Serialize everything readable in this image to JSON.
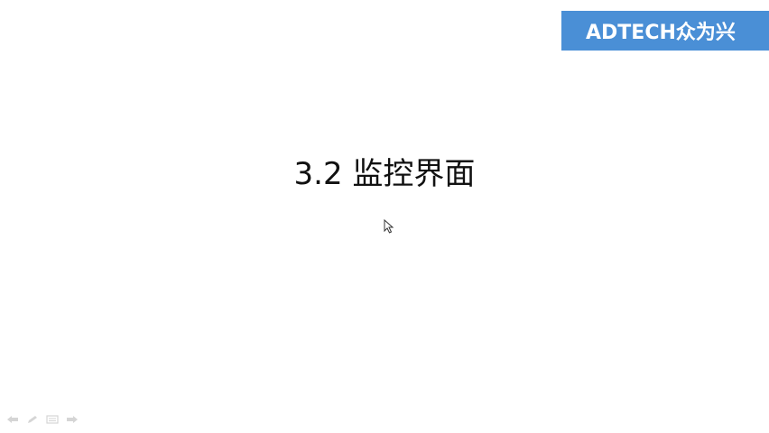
{
  "brand": {
    "text": "ADTECH众为兴",
    "background_color": "#4a8fd6",
    "text_color": "#ffffff"
  },
  "slide": {
    "title": "3.2 监控界面"
  },
  "nav_controls": [
    {
      "icon": "previous-arrow-icon"
    },
    {
      "icon": "pen-icon"
    },
    {
      "icon": "menu-icon"
    },
    {
      "icon": "next-arrow-icon"
    }
  ],
  "cursor": {
    "icon": "mouse-pointer-icon"
  }
}
